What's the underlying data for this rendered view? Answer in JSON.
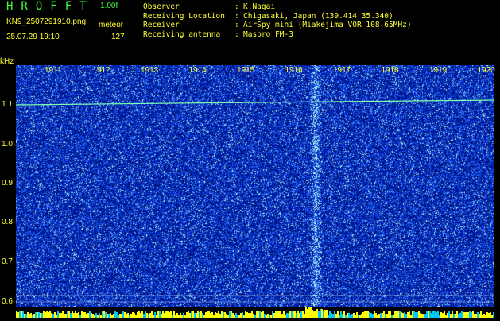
{
  "header": {
    "app_logo": "HROFFT",
    "version": "1.00f",
    "filename": "KN9_2507291910.png",
    "mode": "meteor",
    "datetime": "25.07.29 19:10",
    "count": "127",
    "info": [
      {
        "key": "Observer",
        "value": "K.Nagai"
      },
      {
        "key": "Receiving Location",
        "value": "Chigasaki, Japan (139.414 35.340)"
      },
      {
        "key": "Receiver",
        "value": "AirSpy mini (Miakejima VOR 108.65MHz)"
      },
      {
        "key": "Receiving antenna",
        "value": "Maspro FM-3"
      }
    ]
  },
  "spectrogram": {
    "y_unit": "kHz",
    "y_ticks": [
      "1.1",
      "1.0",
      "0.9",
      "0.8",
      "0.7",
      "0.6"
    ],
    "x_ticks": [
      "1911",
      "1912",
      "1913",
      "1914",
      "1915",
      "1916",
      "1917",
      "1918",
      "1919",
      "1920"
    ],
    "colors": {
      "background": "#000000",
      "noise_dark": "#001a8c",
      "noise_mid": "#1d55ff",
      "noise_bright": "#7ae0ff",
      "grid": "#5aa0ff",
      "label": "#ffff33",
      "carrier": "#7fffb0"
    }
  }
}
